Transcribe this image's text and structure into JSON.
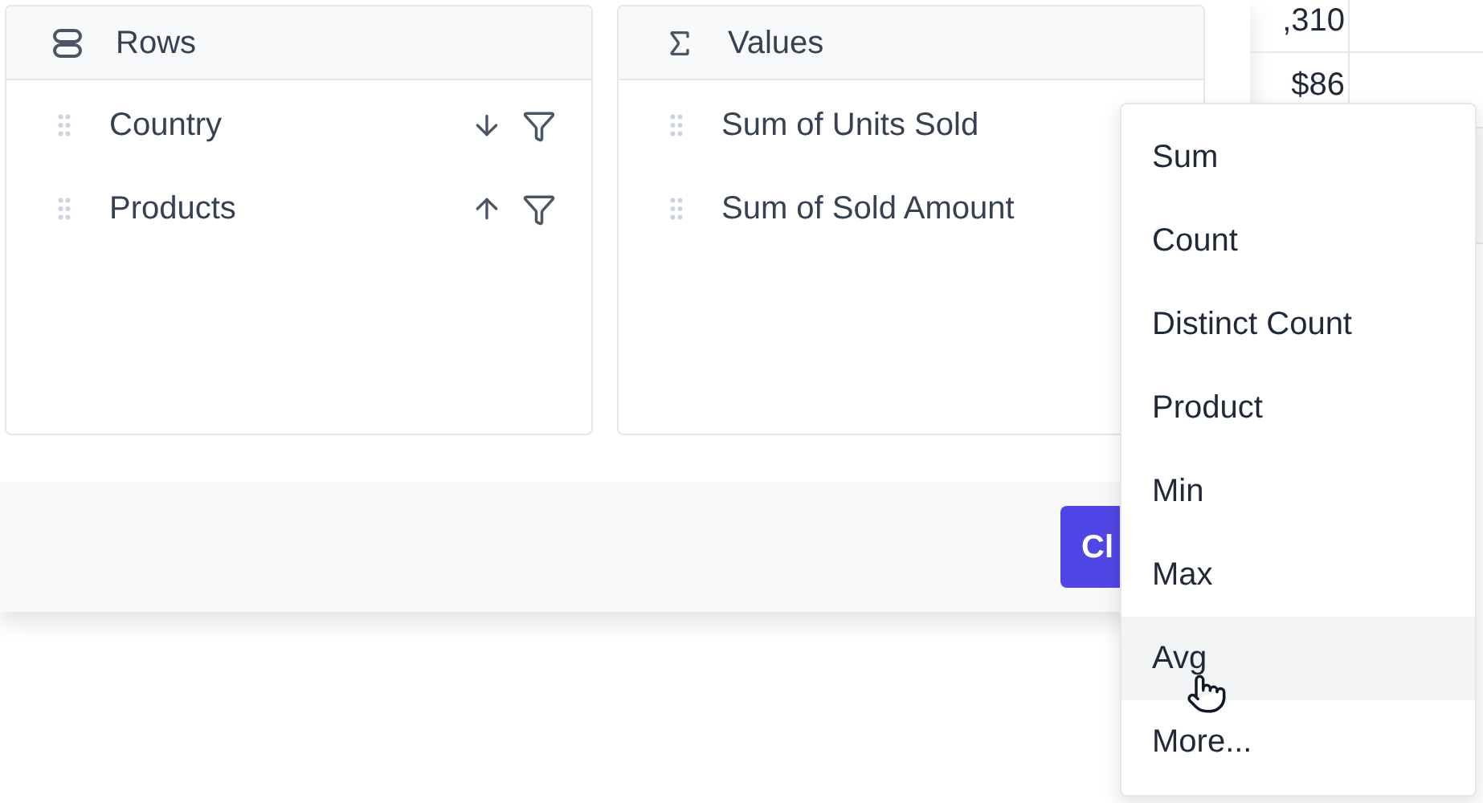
{
  "panels": [
    {
      "kind": "rows",
      "title": "Rows",
      "fields": [
        {
          "label": "Country",
          "descending": true
        },
        {
          "label": "Products",
          "descending": false
        }
      ]
    },
    {
      "kind": "values",
      "title": "Values",
      "fields": [
        {
          "label": "Sum of Units Sold"
        },
        {
          "label": "Sum of Sold Amount"
        }
      ]
    }
  ],
  "footer": {
    "button": "Cl"
  },
  "table": {
    "rows": [
      {
        "cells": [
          ",310"
        ]
      },
      {
        "cells": [
          "$86"
        ]
      }
    ]
  },
  "menu": {
    "items": [
      {
        "label": "Sum",
        "hovered": false
      },
      {
        "label": "Count",
        "hovered": false
      },
      {
        "label": "Distinct Count",
        "hovered": false
      },
      {
        "label": "Product",
        "hovered": false
      },
      {
        "label": "Min",
        "hovered": false
      },
      {
        "label": "Max",
        "hovered": false
      },
      {
        "label": "Avg",
        "hovered": true
      },
      {
        "label": "More...",
        "hovered": false
      }
    ]
  }
}
